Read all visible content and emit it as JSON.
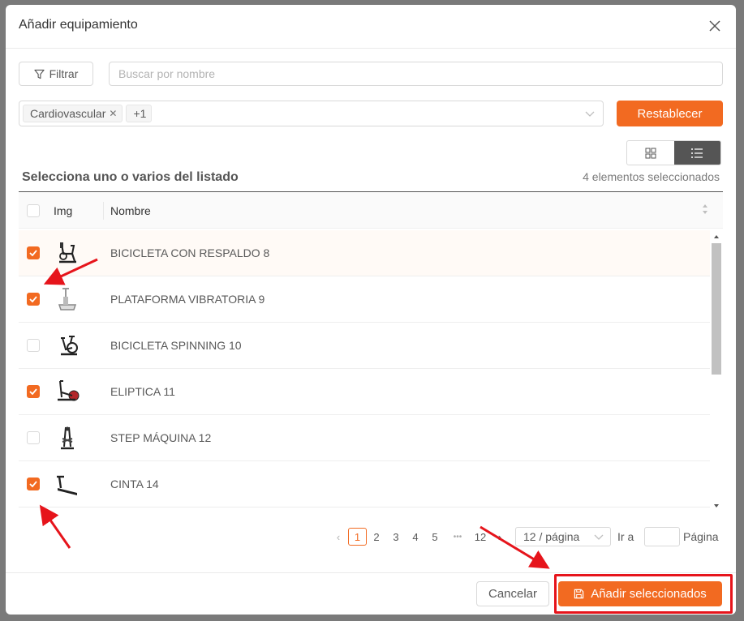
{
  "modal": {
    "title": "Añadir equipamiento",
    "filter_label": "Filtrar",
    "search_placeholder": "Buscar por nombre",
    "tags": [
      "Cardiovascular"
    ],
    "tags_more": "+1",
    "reset_label": "Restablecer",
    "section_title": "Selecciona uno o varios del listado",
    "selected_count": "4 elementos seleccionados"
  },
  "table": {
    "col_img": "Img",
    "col_name": "Nombre",
    "rows": [
      {
        "name": "BICICLETA CON RESPALDO 8",
        "checked": true,
        "icon": "recumbent-bike-icon"
      },
      {
        "name": "PLATAFORMA VIBRATORIA 9",
        "checked": true,
        "icon": "vibration-platform-icon"
      },
      {
        "name": "BICICLETA SPINNING 10",
        "checked": false,
        "icon": "spinning-bike-icon"
      },
      {
        "name": "ELIPTICA 11",
        "checked": true,
        "icon": "elliptical-icon"
      },
      {
        "name": "STEP MÁQUINA 12",
        "checked": false,
        "icon": "stepper-icon"
      },
      {
        "name": "CINTA 14",
        "checked": true,
        "icon": "treadmill-icon"
      }
    ]
  },
  "pagination": {
    "pages": [
      "1",
      "2",
      "3",
      "4",
      "5"
    ],
    "current": "1",
    "ellipsis": "•••",
    "last": "12",
    "page_size": "12 / página",
    "goto_label": "Ir a",
    "pagina_label": "Página"
  },
  "footer": {
    "cancel_label": "Cancelar",
    "add_label": "Añadir seleccionados"
  },
  "colors": {
    "accent": "#f26a21",
    "annotation": "#e6141b"
  }
}
